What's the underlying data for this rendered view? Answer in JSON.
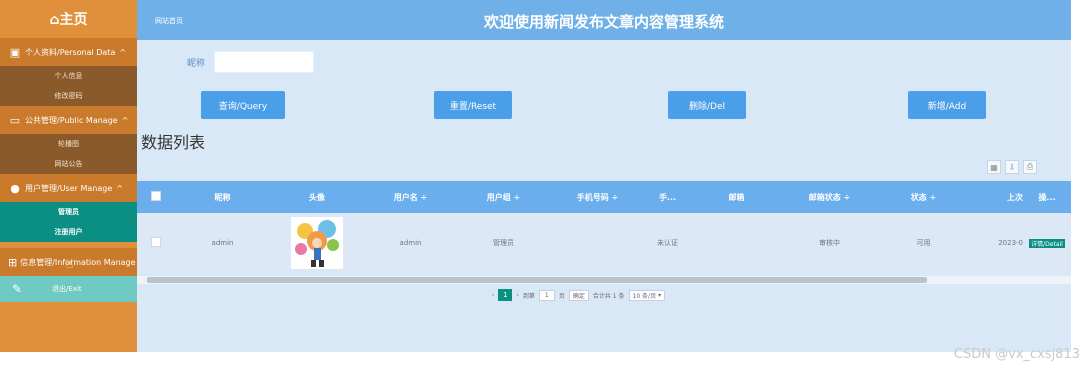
{
  "sidebar": {
    "home": "⌂主页",
    "groups": [
      {
        "label": "个人资料/Personal Data",
        "chevron": "^",
        "items": [
          "个人信息",
          "修改密码"
        ]
      },
      {
        "label": "公共管理/Public Manage",
        "chevron": "^",
        "items": [
          "轮播图",
          "网站公告"
        ]
      },
      {
        "label": "用户管理/User Manage",
        "chevron": "^",
        "items": [
          "管理员",
          "注册用户"
        ]
      },
      {
        "label": "信息管理/Information Manage",
        "chevron": "v",
        "items": []
      }
    ],
    "logout": "退出/Exit"
  },
  "header": {
    "breadcrumb": "网站首页",
    "title": "欢迎使用新闻发布文章内容管理系统"
  },
  "search": {
    "label": "昵称",
    "value": ""
  },
  "buttons": {
    "query": "查询/Query",
    "reset": "重置/Reset",
    "delete": "删除/Del",
    "add": "新增/Add"
  },
  "list_title": "数据列表",
  "table": {
    "headers": [
      "昵称",
      "头像",
      "用户名 ÷",
      "用户组 ÷",
      "手机号码 ÷",
      "手...",
      "邮箱",
      "邮箱状态 ÷",
      "状态 ÷",
      "上次",
      "操..."
    ],
    "rows": [
      {
        "nickname": "admin",
        "username": "admin",
        "group": "管理员",
        "phone": "",
        "short": "未认证",
        "email": "",
        "email_status": "审核中",
        "status": "可用",
        "last": "2023-0",
        "action": "详情/Detail"
      }
    ]
  },
  "pager": {
    "current": "1",
    "goto_label": "到第",
    "page_value": "1",
    "page_unit": "页",
    "confirm": "确定",
    "total": "合计共 1 条",
    "per_page": "10 条/页"
  },
  "watermark": "CSDN @vx_cxsj813",
  "colors": {
    "sidebar": "#e08f3a",
    "header": "#6fb0e8",
    "main_bg": "#d9e8f7",
    "button": "#4b9fe8",
    "teal": "#0b8f83"
  }
}
